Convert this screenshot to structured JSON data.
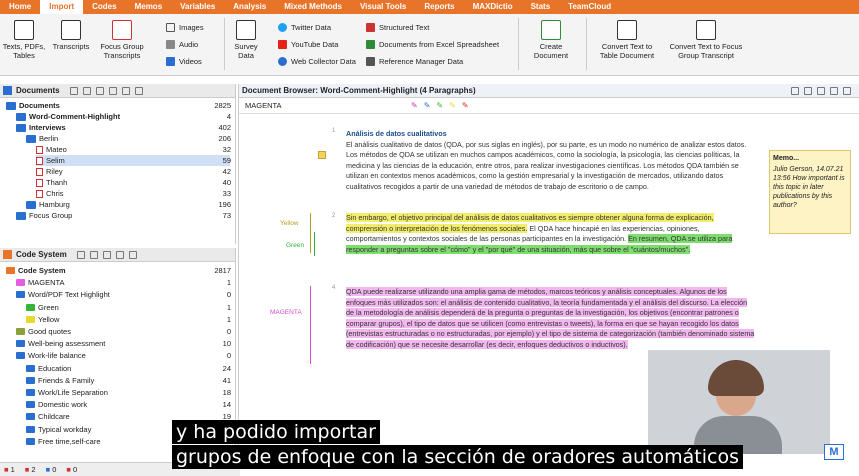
{
  "menu": {
    "tabs": [
      "Home",
      "Import",
      "Codes",
      "Memos",
      "Variables",
      "Analysis",
      "Mixed Methods",
      "Visual Tools",
      "Reports",
      "MAXDictio",
      "Stats",
      "TeamCloud"
    ],
    "active": "Import"
  },
  "ribbon": {
    "texts": "Texts, PDFs, Tables",
    "transcripts": "Transcripts",
    "focus": "Focus Group Transcripts",
    "images": "Images",
    "audio": "Audio",
    "videos": "Videos",
    "survey": "Survey Data",
    "twitter": "Twitter Data",
    "youtube": "YouTube Data",
    "webcollector": "Web Collector Data",
    "structured": "Structured Text",
    "excel": "Documents from Excel Spreadsheet",
    "refmgr": "Reference Manager Data",
    "create": "Create Document",
    "convert_table": "Convert Text to Table Document",
    "convert_focus": "Convert Text to Focus Group Transcript"
  },
  "docsystem": {
    "title": "Documents",
    "count_hdr": "2825",
    "rows": [
      {
        "label": "Documents",
        "count": "2825",
        "indent": 0
      },
      {
        "label": "Word-Comment-Highlight",
        "count": "4",
        "indent": 1
      },
      {
        "label": "Interviews",
        "count": "402",
        "indent": 1
      },
      {
        "label": "Berlin",
        "count": "206",
        "indent": 2
      },
      {
        "label": "Mateo",
        "count": "32",
        "indent": 3
      },
      {
        "label": "Selim",
        "count": "59",
        "indent": 3
      },
      {
        "label": "Riley",
        "count": "42",
        "indent": 3
      },
      {
        "label": "Thanh",
        "count": "40",
        "indent": 3
      },
      {
        "label": "Chris",
        "count": "33",
        "indent": 3
      },
      {
        "label": "Hamburg",
        "count": "196",
        "indent": 2
      },
      {
        "label": "Focus Group",
        "count": "73",
        "indent": 1
      }
    ]
  },
  "codesystem": {
    "title": "Code System",
    "rows": [
      {
        "label": "Code System",
        "count": "2817",
        "indent": 0,
        "color": ""
      },
      {
        "label": "MAGENTA",
        "count": "1",
        "indent": 1,
        "color": "#e55de0"
      },
      {
        "label": "Word/PDF Text Highlight",
        "count": "0",
        "indent": 1,
        "color": "#2a6fcf"
      },
      {
        "label": "Green",
        "count": "1",
        "indent": 2,
        "color": "#35b535"
      },
      {
        "label": "Yellow",
        "count": "1",
        "indent": 2,
        "color": "#e8d830"
      },
      {
        "label": "Good quotes",
        "count": "0",
        "indent": 1,
        "color": "#8aa03a"
      },
      {
        "label": "Well-being assessment",
        "count": "10",
        "indent": 1,
        "color": "#2a6fcf"
      },
      {
        "label": "Work-life balance",
        "count": "0",
        "indent": 1,
        "color": "#2a6fcf"
      },
      {
        "label": "Education",
        "count": "24",
        "indent": 2,
        "color": "#2a6fcf"
      },
      {
        "label": "Friends & Family",
        "count": "41",
        "indent": 2,
        "color": "#2a6fcf"
      },
      {
        "label": "Work/Life Separation",
        "count": "18",
        "indent": 2,
        "color": "#2a6fcf"
      },
      {
        "label": "Domestic work",
        "count": "14",
        "indent": 2,
        "color": "#2a6fcf"
      },
      {
        "label": "Childcare",
        "count": "19",
        "indent": 2,
        "color": "#2a6fcf"
      },
      {
        "label": "Typical workday",
        "count": "17",
        "indent": 2,
        "color": "#2a6fcf"
      },
      {
        "label": "Free time,self-care",
        "count": "16",
        "indent": 2,
        "color": "#2a6fcf"
      }
    ]
  },
  "browser": {
    "title": "Document Browser: Word-Comment-Highlight  (4 Paragraphs)",
    "code_field": "MAGENTA",
    "heading": "Análisis de datos cualitativos",
    "p1": "El análisis cualitativo de datos (QDA, por sus siglas en inglés), por su parte, es un modo no numérico de analizar estos datos. Los métodos de QDA se utilizan en muchos campos académicos, como la sociología, la psicología, las ciencias políticas, la medicina y las ciencias de la educación, entre otros, para realizar investigaciones científicas. Los métodos QDA también se utilizan en contextos menos académicos, como la gestión empresarial y la investigación de mercados, utilizando datos cualitativos recogidos a partir de una variedad de métodos de trabajo de escritorio o de campo.",
    "p2_yellow": "Sin embargo, el objetivo principal del análisis de datos cualitativos es siempre obtener alguna forma de explicación, comprensión o interpretación de los fenómenos sociales.",
    "p2_plain": " El QDA hace hincapié en las experiencias, opiniones, comportamientos y contextos sociales de las personas participantes en la investigación. ",
    "p2_green": "En resumen, QDA se utiliza para responder a preguntas sobre el \"cómo\" y el \"por qué\" de una situación, más que sobre el \"cuántos/muchos\".",
    "p3": "QDA puede realizarse utilizando una amplia gama de métodos, marcos teóricos y análisis conceptuales. Algunos de los enfoques más utilizados son: el análisis de contenido cualitativo, la teoría fundamentada y el análisis del discurso. La elección de la metodología de análisis dependerá de la pregunta o preguntas de la investigación, los objetivos (encontrar patrones o comparar grupos), el tipo de datos que se utilicen (como entrevistas o tweets), la forma en que se hayan recogido los datos (entrevistas estructuradas o no estructuradas, por ejemplo) y el tipo de sistema de categorización (también denominado sistema de codificación) que se necesite desarrollar (es decir, enfoques deductivos o inductivos).",
    "para_nums": [
      "1",
      "2",
      "3",
      "4"
    ],
    "code_labels": {
      "yellow": "Yellow",
      "green": "Green",
      "magenta": "MAGENTA"
    }
  },
  "memo": {
    "title": "Memo...",
    "text": "Julio Gerson, 14.07.21 13:56 How important is this topic in later publications by this author?"
  },
  "subtitles": [
    "y ha podido importar",
    "grupos de enfoque con la sección de oradores automáticos"
  ],
  "status": [
    "1",
    "2",
    "0",
    "0"
  ],
  "colors": {
    "accent": "#e8742a"
  }
}
